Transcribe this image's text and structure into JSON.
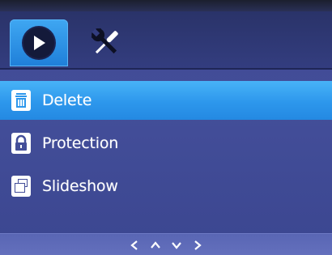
{
  "tabs": [
    {
      "name": "playback",
      "icon": "play-icon",
      "active": true
    },
    {
      "name": "settings",
      "icon": "tools-icon",
      "active": false
    }
  ],
  "menu": {
    "items": [
      {
        "label": "Delete",
        "icon": "trash-icon",
        "selected": true
      },
      {
        "label": "Protection",
        "icon": "lock-icon",
        "selected": false
      },
      {
        "label": "Slideshow",
        "icon": "slideshow-icon",
        "selected": false
      }
    ]
  },
  "footer": {
    "nav_icons": [
      "left-arrow-icon",
      "up-arrow-icon",
      "down-arrow-icon",
      "right-arrow-icon"
    ]
  },
  "colors": {
    "background": "#434e99",
    "highlight": "#2d97ec",
    "active_tab": "#2f93e8",
    "text": "#ffffff"
  }
}
